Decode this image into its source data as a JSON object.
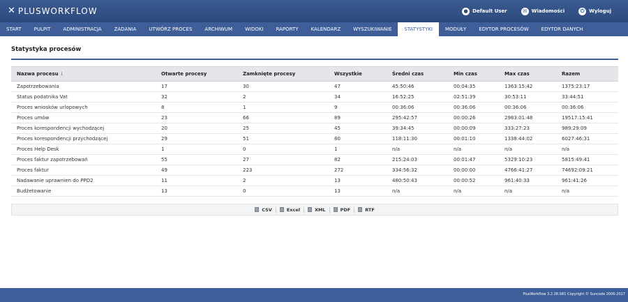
{
  "app": {
    "logo_mark": "✕",
    "logo_text": "PLUSWORKFLOW"
  },
  "user_menu": {
    "user": "Default User",
    "messages": "Wiadomości",
    "logout": "Wyloguj"
  },
  "nav": {
    "items": [
      "START",
      "PULPIT",
      "ADMINISTRACJA",
      "ZADANIA",
      "UTWÓRZ PROCES",
      "ARCHIWUM",
      "WIDOKI",
      "RAPORTY",
      "KALENDARZ",
      "WYSZUKIWANIE",
      "STATYSTYKI",
      "MODUŁY",
      "EDYTOR PROCESÓW",
      "EDYTOR DANYCH"
    ],
    "active": "STATYSTYKI"
  },
  "page": {
    "title": "Statystyka procesów"
  },
  "table": {
    "headers": [
      "Nazwa procesu",
      "Otwarte procesy",
      "Zamknięte procesy",
      "Wszystkie",
      "Średni czas",
      "Min czas",
      "Max czas",
      "Razem"
    ],
    "sort_icon": "↓",
    "rows": [
      [
        "Zapotrzebowania",
        "17",
        "30",
        "47",
        "45:50:46",
        "00:04:35",
        "1363:15:42",
        "1375:23:17"
      ],
      [
        "Status podatnika Vat",
        "32",
        "2",
        "34",
        "16:52:25",
        "02:51:39",
        "30:53:11",
        "33:44:51"
      ],
      [
        "Proces wniosków urlopowych",
        "8",
        "1",
        "9",
        "00:36:06",
        "00:36:06",
        "00:36:06",
        "00:36:06"
      ],
      [
        "Proces umów",
        "23",
        "66",
        "89",
        "295:42:57",
        "00:00:26",
        "2983:01:48",
        "19517:15:41"
      ],
      [
        "Proces korespondencji wychodzącej",
        "20",
        "25",
        "45",
        "39:34:45",
        "00:00:09",
        "333:27:23",
        "989:29:09"
      ],
      [
        "Proces korespondencji przychodzącej",
        "29",
        "51",
        "80",
        "118:11:30",
        "00:01:10",
        "1338:44:02",
        "6027:46:31"
      ],
      [
        "Proces Help Desk",
        "1",
        "0",
        "1",
        "n/a",
        "n/a",
        "n/a",
        "n/a"
      ],
      [
        "Proces faktur zapotrzebowań",
        "55",
        "27",
        "82",
        "215:24:03",
        "00:01:47",
        "5329:10:23",
        "5815:49:41"
      ],
      [
        "Proces faktur",
        "49",
        "223",
        "272",
        "334:56:32",
        "00:00:00",
        "4766:41:27",
        "74692:09:21"
      ],
      [
        "Nadawanie uprawnien do PPD2",
        "11",
        "2",
        "13",
        "480:50:43",
        "00:00:52",
        "961:40:33",
        "961:41:26"
      ],
      [
        "Budżetowanie",
        "13",
        "0",
        "13",
        "n/a",
        "n/a",
        "n/a",
        "n/a"
      ]
    ]
  },
  "export": {
    "buttons": [
      "CSV",
      "Excel",
      "XML",
      "PDF",
      "RTF"
    ]
  },
  "footer": {
    "text": "PlusWorkflow 3.2.28.SR1 Copyright © Suncode 2006-2017"
  },
  "colors": {
    "header_bg": "#2d4a7c",
    "nav_bg": "#3d5e98",
    "active_tab_bg": "#ffffff",
    "table_header_bg": "#e4e6ea"
  },
  "icons": {
    "user": "user-icon",
    "messages": "envelope-icon",
    "logout": "power-icon",
    "export": "document-icon"
  }
}
